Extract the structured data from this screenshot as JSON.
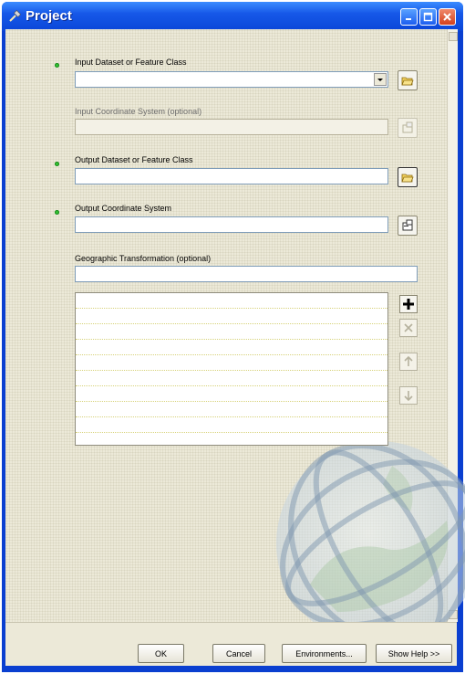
{
  "window": {
    "title": "Project"
  },
  "params": {
    "input_dataset": {
      "label": "Input Dataset or Feature Class",
      "value": ""
    },
    "input_cs": {
      "label": "Input Coordinate System (optional)",
      "value": ""
    },
    "output_dataset": {
      "label": "Output Dataset or Feature Class",
      "value": ""
    },
    "output_cs": {
      "label": "Output Coordinate System",
      "value": ""
    },
    "geo_transform": {
      "label": "Geographic Transformation (optional)",
      "value": ""
    }
  },
  "buttons": {
    "ok": "OK",
    "cancel": "Cancel",
    "environments": "Environments...",
    "show_help": "Show Help >>"
  },
  "colors": {
    "required_dot": "#33c233",
    "title_bar": "#0a46d8"
  }
}
